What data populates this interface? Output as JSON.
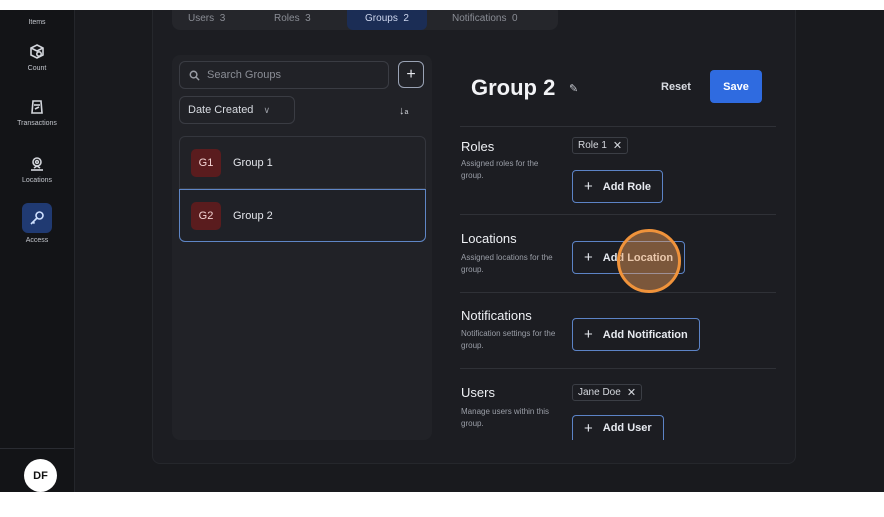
{
  "sidebar": {
    "items": [
      {
        "label": "Items",
        "icon": "items-icon"
      },
      {
        "label": "Count",
        "icon": "count-box-icon"
      },
      {
        "label": "Transactions",
        "icon": "transactions-icon"
      },
      {
        "label": "Locations",
        "icon": "location-pin-icon"
      },
      {
        "label": "Access",
        "icon": "key-icon",
        "active": true
      }
    ],
    "avatar": "DF"
  },
  "tabs": [
    {
      "label": "Users",
      "count": "3"
    },
    {
      "label": "Roles",
      "count": "3"
    },
    {
      "label": "Groups",
      "count": "2",
      "active": true
    },
    {
      "label": "Notifications",
      "count": "0"
    }
  ],
  "list": {
    "search_placeholder": "Search Groups",
    "add_symbol": "+",
    "sort_label": "Date Created",
    "sort_chevron": "∨",
    "sort_icon": "↓",
    "groups": [
      {
        "badge": "G1",
        "name": "Group 1"
      },
      {
        "badge": "G2",
        "name": "Group 2",
        "selected": true
      }
    ]
  },
  "detail": {
    "title": "Group 2",
    "reset_label": "Reset",
    "save_label": "Save",
    "sections": [
      {
        "title": "Roles",
        "desc": "Assigned roles for the group.",
        "chip": "Role 1",
        "button": "Add Role"
      },
      {
        "title": "Locations",
        "desc": "Assigned locations for the group.",
        "button": "Add Location"
      },
      {
        "title": "Notifications",
        "desc": "Notification settings for the group.",
        "button": "Add Notification"
      },
      {
        "title": "Users",
        "desc": "Manage users within this group.",
        "chip": "Jane Doe",
        "button": "Add User"
      }
    ]
  },
  "colors": {
    "accent": "#2f6be0",
    "badge_bg": "#5a1c1e",
    "highlight_ring": "#f0933b"
  }
}
